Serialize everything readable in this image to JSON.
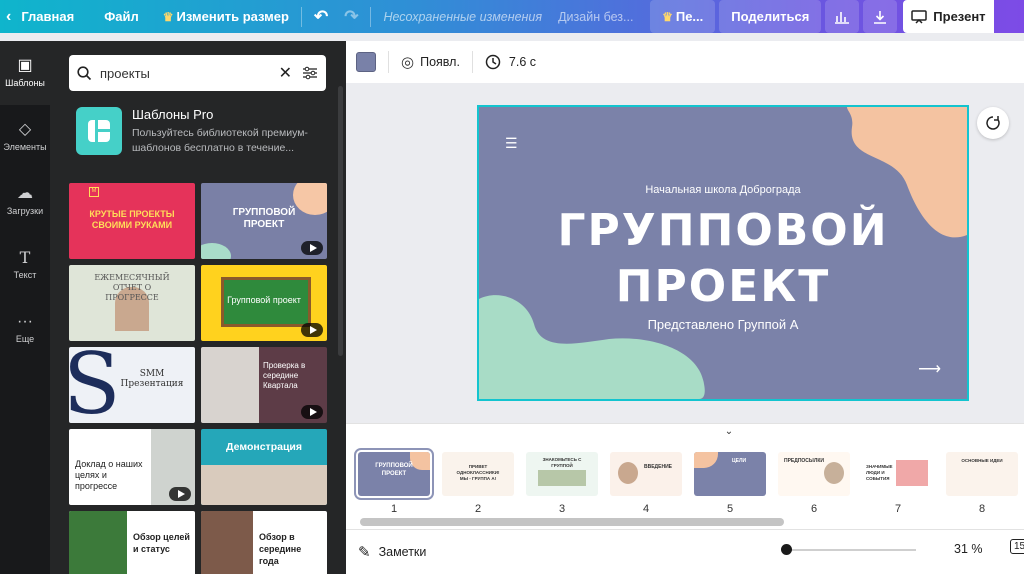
{
  "topbar": {
    "home": "Главная",
    "file": "Файл",
    "resize": "Изменить размер",
    "unsaved": "Несохраненные изменения",
    "design_title": "Дизайн без...",
    "pro_label": "Пе...",
    "share": "Поделиться",
    "present": "Презент"
  },
  "rail": {
    "templates": "Шаблоны",
    "elements": "Элементы",
    "uploads": "Загрузки",
    "text": "Текст",
    "more": "Еще"
  },
  "search": {
    "value": "проекты",
    "placeholder": ""
  },
  "promo": {
    "title": "Шаблоны Pro",
    "desc": "Пользуйтесь библиотекой премиум-шаблонов бесплатно в течение..."
  },
  "templates": [
    {
      "text": "КРУТЫЕ ПРОЕКТЫ СВОИМИ РУКАМИ"
    },
    {
      "text": "ГРУППОВОЙ ПРОЕКТ"
    },
    {
      "text": "ЕЖЕМЕСЯЧНЫЙ ОТЧЕТ О ПРОГРЕССЕ"
    },
    {
      "text": "Групповой проект"
    },
    {
      "text": "SMM Презентация"
    },
    {
      "text": "Проверка в середине Квартала"
    },
    {
      "text": "Доклад о наших целях и прогрессе"
    },
    {
      "text": "Демонстрация"
    },
    {
      "text": "Обзор целей и статус"
    },
    {
      "text": "Обзор в середине года"
    }
  ],
  "editor_toolbar": {
    "swatch_color": "#7981a8",
    "animate": "Появл.",
    "duration": "7.6 с"
  },
  "slide": {
    "school": "Начальная школа Доброграда",
    "title_line1": "Групповой",
    "title_line2": "Проект",
    "subtitle": "Представлено Группой А",
    "bg_color": "#7b82a9"
  },
  "pages": [
    {
      "num": "1",
      "label": "ГРУППОВОЙ ПРОЕКТ"
    },
    {
      "num": "2",
      "label": "ПРИВЕТ ОДНОКЛАССНИКИ! МЫ - ГРУППА А!"
    },
    {
      "num": "3",
      "label": "ЗНАКОМЬТЕСЬ С ГРУППОЙ"
    },
    {
      "num": "4",
      "label": "ВВЕДЕНИЕ"
    },
    {
      "num": "5",
      "label": "ЦЕЛИ"
    },
    {
      "num": "6",
      "label": "ПРЕДПОСЫЛКИ"
    },
    {
      "num": "7",
      "label": "ЗНАЧИМЫЕ ЛЮДИ И СОБЫТИЯ"
    },
    {
      "num": "8",
      "label": "ОСНОВНЫЕ ИДЕИ"
    }
  ],
  "footer": {
    "notes": "Заметки",
    "zoom": "31 %",
    "page_count": "15"
  }
}
